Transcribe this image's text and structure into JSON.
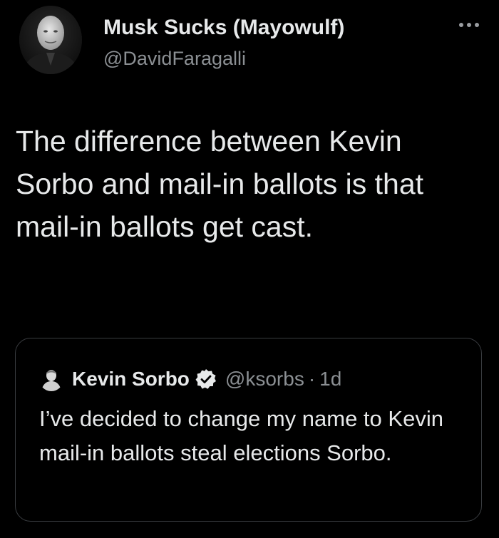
{
  "tweet": {
    "author": {
      "display_name": "Musk Sucks (Mayowulf)",
      "handle": "@DavidFaragalli",
      "avatar_icon": "person-avatar-icon"
    },
    "more_icon": "more-options-icon",
    "text": "The difference between Kevin Sorbo and mail-in ballots is that mail-in ballots get cast."
  },
  "quote": {
    "author": {
      "display_name": "Kevin Sorbo",
      "handle": "@ksorbs",
      "separator": "·",
      "time": "1d",
      "verified_icon": "verified-badge-icon"
    },
    "text": "I’ve decided to change my name to Kevin mail-in ballots steal elections Sorbo."
  },
  "colors": {
    "background": "#000000",
    "primary_text": "#e7e9ea",
    "secondary_text": "#8b8f93",
    "card_border": "#3a3d41"
  }
}
